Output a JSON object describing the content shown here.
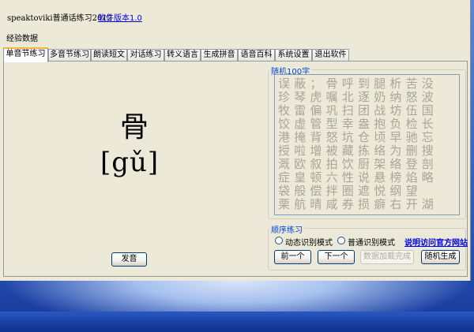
{
  "app": {
    "title": "speaktoviki普通话练习2012",
    "version_link": "软件版本1.0",
    "menu": "经验数据"
  },
  "tabs": [
    {
      "label": "单音节练习",
      "active": true
    },
    {
      "label": "多音节练习",
      "active": false
    },
    {
      "label": "朗读短文",
      "active": false
    },
    {
      "label": "对话练习",
      "active": false
    },
    {
      "label": "转义语言",
      "active": false
    },
    {
      "label": "生成拼音",
      "active": false
    },
    {
      "label": "语音百科",
      "active": false
    },
    {
      "label": "系统设置",
      "active": false
    },
    {
      "label": "退出软件",
      "active": false
    }
  ],
  "practice": {
    "character": "骨",
    "pinyin": "[gǔ]",
    "speak_button": "发音"
  },
  "random_group": {
    "legend": "随机100字",
    "rows": [
      "误蔽；骨呼到腿析苦没",
      "珍琴虎嘱北逐奶纳怒波",
      "牧雷偏巩扫团战坊伍国",
      "饺虚管型幸盎抱负检长",
      "港掩背怒坑仓顷早驰忘",
      "授啦增被藏拣络为删搜",
      "溉欧叙拍饮厨架络登剖",
      "症皇顿六性说悬榜焰略",
      "袋般偿拌圈遮悦纲望",
      "栗航晴咸券损癖右开湖"
    ]
  },
  "order_group": {
    "legend": "顺序练习",
    "mode_dynamic": "动态识别模式",
    "mode_normal": "普通识别模式",
    "help_link": "说明访问官方网站",
    "prev_button": "前一个",
    "next_button": "下一个",
    "load_button": "数据加载完成",
    "random_button": "随机生成"
  },
  "edge_glyphs": [
    "设",
    "(",
    "成",
    "C"
  ]
}
